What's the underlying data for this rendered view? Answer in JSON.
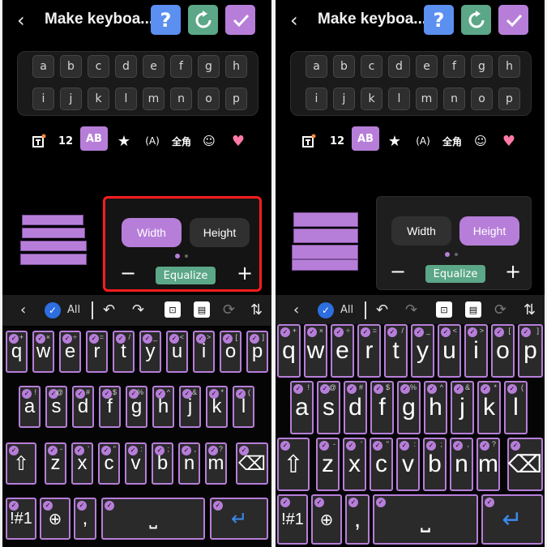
{
  "header": {
    "title": "Make keyboa...",
    "help": "?"
  },
  "preview_keys": [
    [
      "a",
      "b",
      "c",
      "d",
      "e",
      "f",
      "g",
      "h"
    ],
    [
      "i",
      "j",
      "k",
      "l",
      "m",
      "n",
      "o",
      "p"
    ]
  ],
  "toolbar": {
    "numbers": "12",
    "case": "AB",
    "circled": "(A)",
    "fullwidth": "全角"
  },
  "size": {
    "width": "Width",
    "height": "Height",
    "equalize": "Equalize",
    "minus": "−",
    "plus": "+"
  },
  "editbar": {
    "all": "All"
  },
  "keyboard": {
    "row1": [
      [
        "q",
        "+"
      ],
      [
        "w",
        "×"
      ],
      [
        "e",
        "÷"
      ],
      [
        "r",
        "="
      ],
      [
        "t",
        "/"
      ],
      [
        "y",
        "_"
      ],
      [
        "u",
        "<"
      ],
      [
        "i",
        ">"
      ],
      [
        "o",
        "["
      ],
      [
        "p",
        "]"
      ]
    ],
    "row2": [
      [
        "a",
        "!"
      ],
      [
        "s",
        "@"
      ],
      [
        "d",
        "#"
      ],
      [
        "f",
        "$"
      ],
      [
        "g",
        "%"
      ],
      [
        "h",
        "^"
      ],
      [
        "j",
        "&"
      ],
      [
        "k",
        "*"
      ],
      [
        "l",
        "("
      ]
    ],
    "row3": [
      [
        "z",
        "-"
      ],
      [
        "x",
        "'"
      ],
      [
        "c",
        "\""
      ],
      [
        "v",
        ":"
      ],
      [
        "b",
        ";"
      ],
      [
        "n",
        ","
      ],
      [
        "m",
        "?"
      ]
    ],
    "symbols": "!#1",
    "comma": ",",
    "space": "⎵",
    "enter": "↵"
  },
  "colors": {
    "accent": "#b77ed9",
    "green": "#5ba788",
    "blue": "#5b8ff0",
    "highlight": "#ff1c1c"
  }
}
